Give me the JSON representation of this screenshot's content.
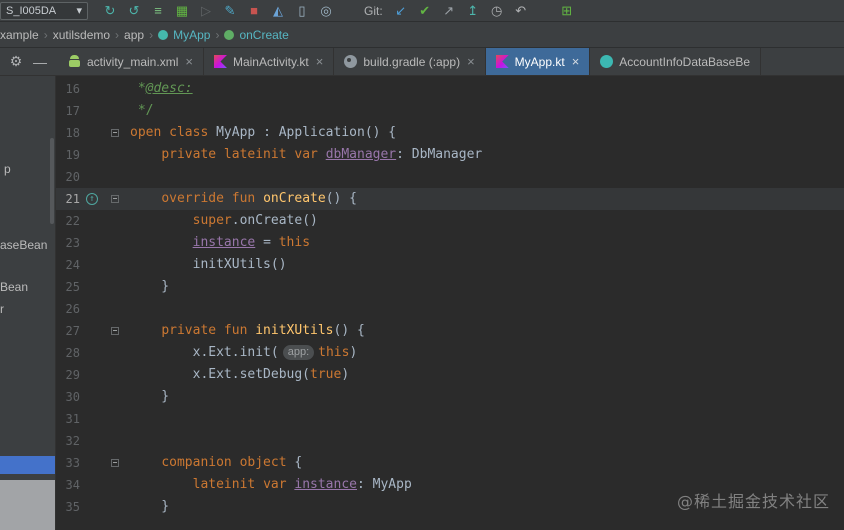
{
  "colors": {
    "editor_bg": "#2b2b2b",
    "panel_bg": "#3c3f41",
    "divider": "#323232",
    "text_default": "#a9b7c6",
    "text_ui": "#bbbbbb",
    "line_number": "#606366",
    "keyword": "#cc7832",
    "function_decl": "#ffc66d",
    "field": "#9876aa",
    "comment": "#629755",
    "current_line_bg": "#353739",
    "active_tab_bg": "#3e6a99",
    "selection_blue": "#4472ca",
    "hint_bg": "#4b4e50",
    "hint_text": "#9da0a2",
    "breadcrumb_accent": "#56b6c2",
    "watermark": "#9a9a9a"
  },
  "toolbar": {
    "device_selector": "S_I005DA",
    "caret_glyph": "▾",
    "git_label": "Git:",
    "left_icons": [
      {
        "name": "sync-project-icon",
        "glyph": "↻",
        "color": "#4db6ac"
      },
      {
        "name": "load-gradle-changes-icon",
        "glyph": "↺",
        "color": "#4db6ac"
      },
      {
        "name": "changelist-icon",
        "glyph": "≡",
        "color": "#7ec482"
      },
      {
        "name": "plugin-icon",
        "glyph": "▦",
        "color": "#62b543"
      },
      {
        "name": "run-disabled-icon",
        "glyph": "▷",
        "color": "#5f6365"
      },
      {
        "name": "edit-configuration-icon",
        "glyph": "✎",
        "color": "#4ea7c6"
      },
      {
        "name": "stop-icon",
        "glyph": "■",
        "color": "#c75450"
      },
      {
        "name": "profiler-icon",
        "glyph": "◭",
        "color": "#6ba3d6"
      },
      {
        "name": "device-manager-icon",
        "glyph": "▯",
        "color": "#9fb6c6"
      },
      {
        "name": "layout-inspector-icon",
        "glyph": "◎",
        "color": "#9fb6c6"
      }
    ],
    "git_icons": [
      {
        "name": "git-update-icon",
        "glyph": "↙",
        "color": "#4e9fd8"
      },
      {
        "name": "git-commit-icon",
        "glyph": "✔",
        "color": "#62b543"
      },
      {
        "name": "git-push-icon",
        "glyph": "↗",
        "color": "#9aa0a6"
      },
      {
        "name": "git-shelve-icon",
        "glyph": "↥",
        "color": "#4db6ac"
      },
      {
        "name": "history-icon",
        "glyph": "◷",
        "color": "#afb1b3"
      },
      {
        "name": "rollback-icon",
        "glyph": "↶",
        "color": "#afb1b3"
      }
    ],
    "tail_icons": [
      {
        "name": "sync-settings-icon",
        "glyph": "⊞",
        "color": "#62b543"
      }
    ]
  },
  "navbar": {
    "separator": "›",
    "items": [
      {
        "label": "xample"
      },
      {
        "label": "xutilsdemo"
      },
      {
        "label": "app"
      },
      {
        "label": "MyApp",
        "icon": "class-run-icon",
        "accent": true
      },
      {
        "label": "onCreate",
        "icon": "method-icon",
        "accent": true
      }
    ]
  },
  "panel": {
    "gear_glyph": "⚙",
    "hide_glyph": "—",
    "fragments": [
      "p",
      "aseBean",
      "Bean",
      "r"
    ]
  },
  "tabs": {
    "close_glyph": "×",
    "items": [
      {
        "label": "activity_main.xml",
        "active": false
      },
      {
        "label": "MainActivity.kt",
        "active": false
      },
      {
        "label": "build.gradle (:app)",
        "active": false
      },
      {
        "label": "MyApp.kt",
        "active": true
      },
      {
        "label": "AccountInfoDataBaseBe",
        "active": false
      }
    ]
  },
  "editor": {
    "override_glyph": "↑",
    "watermark": "@稀土掘金技术社区",
    "current_line": 21,
    "lines": [
      {
        "n": 16,
        "tokens": [
          [
            " *",
            "cm"
          ],
          [
            "@desc:",
            "kd"
          ]
        ]
      },
      {
        "n": 17,
        "tokens": [
          [
            " */",
            "cm"
          ]
        ]
      },
      {
        "n": 18,
        "fold": true,
        "tokens": [
          [
            "open class",
            "kw"
          ],
          [
            " MyApp : Application() {",
            "pl"
          ]
        ]
      },
      {
        "n": 19,
        "tokens": [
          [
            "    ",
            "pl"
          ],
          [
            "private lateinit var",
            "kw"
          ],
          [
            " ",
            "pl"
          ],
          [
            "dbManager",
            "fld"
          ],
          [
            ": DbManager",
            "pl"
          ]
        ]
      },
      {
        "n": 20,
        "tokens": []
      },
      {
        "n": 21,
        "current": true,
        "override": true,
        "fold": true,
        "tokens": [
          [
            "    ",
            "pl"
          ],
          [
            "override fun",
            "kw"
          ],
          [
            " ",
            "pl"
          ],
          [
            "onCreate",
            "fn"
          ],
          [
            "() {",
            "pl"
          ]
        ]
      },
      {
        "n": 22,
        "tokens": [
          [
            "        ",
            "pl"
          ],
          [
            "super",
            "kw"
          ],
          [
            ".onCreate()",
            "pl"
          ]
        ]
      },
      {
        "n": 23,
        "tokens": [
          [
            "        ",
            "pl"
          ],
          [
            "instance",
            "fld"
          ],
          [
            " = ",
            "pl"
          ],
          [
            "this",
            "kw"
          ]
        ]
      },
      {
        "n": 24,
        "tokens": [
          [
            "        initXUtils()",
            "pl"
          ]
        ]
      },
      {
        "n": 25,
        "tokens": [
          [
            "    }",
            "pl"
          ]
        ]
      },
      {
        "n": 26,
        "tokens": []
      },
      {
        "n": 27,
        "fold": true,
        "tokens": [
          [
            "    ",
            "pl"
          ],
          [
            "private fun",
            "kw"
          ],
          [
            " ",
            "pl"
          ],
          [
            "initXUtils",
            "fn"
          ],
          [
            "() {",
            "pl"
          ]
        ]
      },
      {
        "n": 28,
        "tokens": [
          [
            "        x.Ext.init(",
            "pl"
          ],
          [
            "app:",
            "hint"
          ],
          [
            "this",
            "kw"
          ],
          [
            ")",
            "pl"
          ]
        ]
      },
      {
        "n": 29,
        "tokens": [
          [
            "        x.Ext.setDebug(",
            "pl"
          ],
          [
            "true",
            "kw"
          ],
          [
            ")",
            "pl"
          ]
        ]
      },
      {
        "n": 30,
        "tokens": [
          [
            "    }",
            "pl"
          ]
        ]
      },
      {
        "n": 31,
        "tokens": []
      },
      {
        "n": 32,
        "tokens": []
      },
      {
        "n": 33,
        "fold": true,
        "tokens": [
          [
            "    ",
            "pl"
          ],
          [
            "companion object",
            "kw"
          ],
          [
            " {",
            "pl"
          ]
        ]
      },
      {
        "n": 34,
        "tokens": [
          [
            "        ",
            "pl"
          ],
          [
            "lateinit var",
            "kw"
          ],
          [
            " ",
            "pl"
          ],
          [
            "instance",
            "fld"
          ],
          [
            ": MyApp",
            "pl"
          ]
        ]
      },
      {
        "n": 35,
        "tokens": [
          [
            "    }",
            "pl"
          ]
        ]
      }
    ]
  }
}
